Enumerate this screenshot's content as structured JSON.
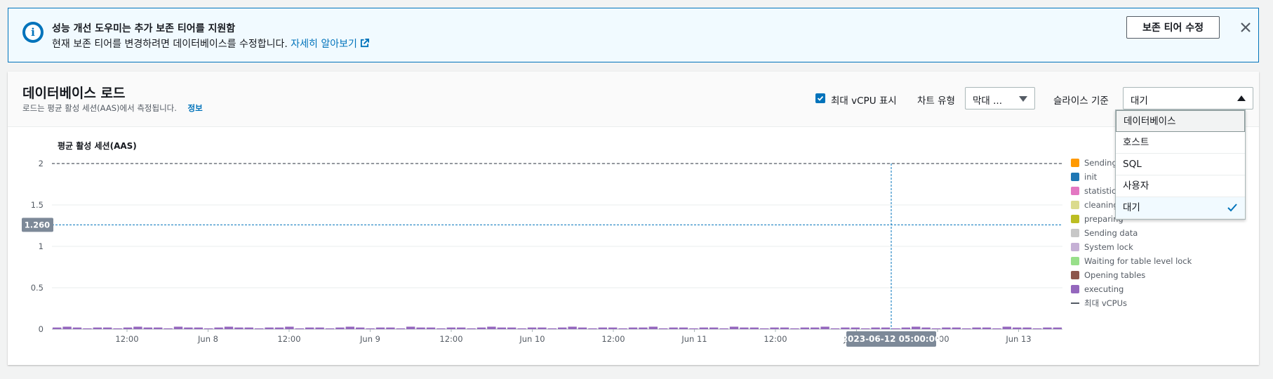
{
  "banner": {
    "title": "성능 개선 도우미는 추가 보존 티어를 지원함",
    "description": "현재 보존 티어를 변경하려면 데이터베이스를 수정합니다.",
    "link_text": "자세히 알아보기",
    "button_label": "보존 티어 수정",
    "icon": "info-icon",
    "close_icon": "close-icon"
  },
  "panel": {
    "title": "데이터베이스 로드",
    "subtitle": "로드는 평균 활성 세션(AAS)에서 측정됩니다.",
    "info_link": "정보",
    "show_max_vcpu_label": "최대 vCPU 표시",
    "show_max_vcpu_checked": true,
    "chart_type_label": "차트 유형",
    "chart_type_value": "막대 ...",
    "slice_label": "슬라이스 기준",
    "slice_value": "대기"
  },
  "slice_options": [
    {
      "label": "데이터베이스",
      "focused": true,
      "selected": false
    },
    {
      "label": "호스트",
      "focused": false,
      "selected": false
    },
    {
      "label": "SQL",
      "focused": false,
      "selected": false
    },
    {
      "label": "사용자",
      "focused": false,
      "selected": false
    },
    {
      "label": "대기",
      "focused": false,
      "selected": true
    }
  ],
  "colors": {
    "accent": "#0073bb",
    "executing": "#9469d6"
  },
  "chart_data": {
    "type": "bar",
    "title": "평균 활성 세션(AAS)",
    "ylim": [
      0,
      2
    ],
    "y_ticks": [
      "0",
      "0.5",
      "1",
      "1.5",
      "2"
    ],
    "x_tick_labels": [
      "12:00",
      "Jun 8",
      "12:00",
      "Jun 9",
      "12:00",
      "Jun 10",
      "12:00",
      "Jun 11",
      "12:00",
      "Jun 12",
      "12:00",
      "Jun 13"
    ],
    "max_vcpus": 2,
    "crosshair": {
      "y_value_label": "1.260",
      "y_value": 1.26,
      "x_label": "2023-06-12 05:00:00"
    },
    "series": [
      {
        "name": "Sending",
        "color": "#ff9900"
      },
      {
        "name": "init",
        "color": "#1f77b4"
      },
      {
        "name": "statistics",
        "color": "#e377c2"
      },
      {
        "name": "cleaning",
        "color": "#dbdb8d"
      },
      {
        "name": "preparing",
        "color": "#bcbd22"
      },
      {
        "name": "Sending data",
        "color": "#c7c7c7"
      },
      {
        "name": "System lock",
        "color": "#c5b0d5"
      },
      {
        "name": "Waiting for table level lock",
        "color": "#98df8a"
      },
      {
        "name": "Opening tables",
        "color": "#8c564b"
      },
      {
        "name": "executing",
        "color": "#9467bd",
        "values": [
          0.02,
          0.03,
          0.02,
          0.01,
          0.02,
          0.02,
          0.01,
          0.02,
          0.03,
          0.02,
          0.02,
          0.01,
          0.03,
          0.02,
          0.02,
          0.01,
          0.02,
          0.03,
          0.02,
          0.02,
          0.01,
          0.02,
          0.02,
          0.03,
          0.01,
          0.02,
          0.02,
          0.01,
          0.02,
          0.03,
          0.02,
          0.01,
          0.02,
          0.02,
          0.01,
          0.03,
          0.02,
          0.02,
          0.01,
          0.02,
          0.02,
          0.01,
          0.02,
          0.03,
          0.02,
          0.02,
          0.01,
          0.02,
          0.02,
          0.01,
          0.02,
          0.03,
          0.02,
          0.01,
          0.02,
          0.02,
          0.01,
          0.02,
          0.02,
          0.03,
          0.01,
          0.02,
          0.02,
          0.01,
          0.02,
          0.02,
          0.01,
          0.03,
          0.02,
          0.02,
          0.01,
          0.02,
          0.02,
          0.01,
          0.02,
          0.02,
          0.03,
          0.01,
          0.02,
          0.02,
          0.01,
          0.02,
          0.02,
          0.01,
          0.02,
          0.03,
          0.02,
          0.01,
          0.02,
          0.02,
          0.01,
          0.02,
          0.02,
          0.01,
          0.03,
          0.02,
          0.02,
          0.01,
          0.02,
          0.02
        ]
      }
    ],
    "max_vcpu_legend": "최대 vCPUs"
  }
}
